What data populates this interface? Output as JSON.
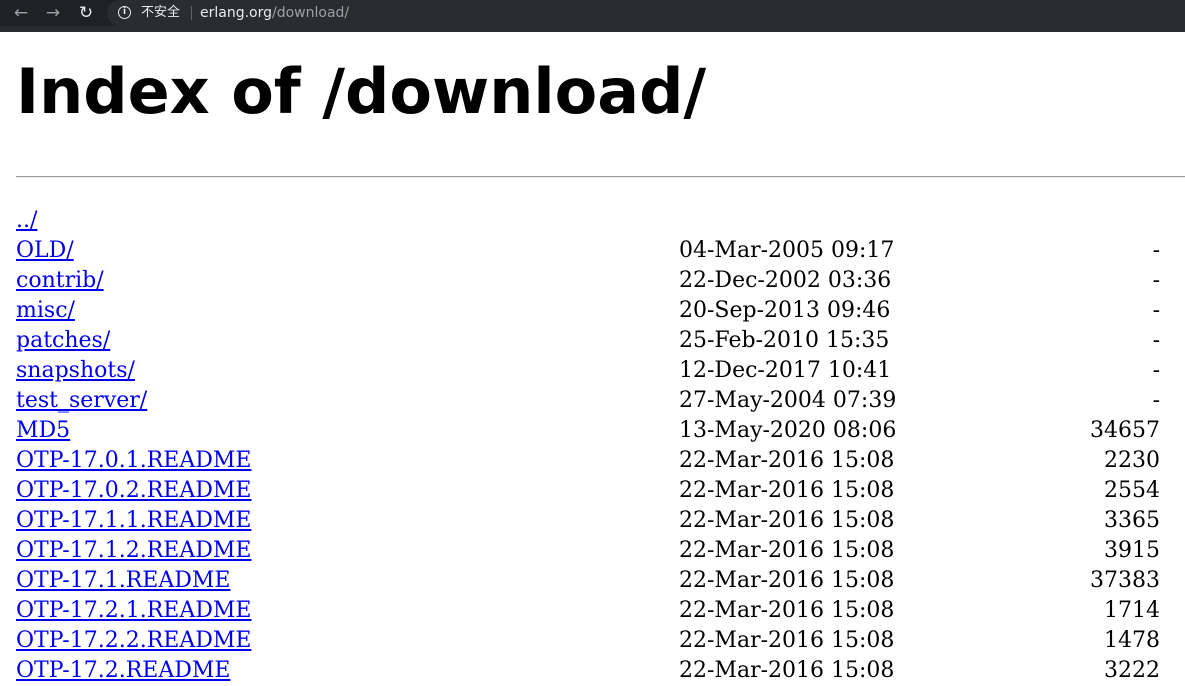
{
  "browser": {
    "security_label": "不安全",
    "url_domain": "erlang.org",
    "url_path": "/download/"
  },
  "page": {
    "title": "Index of /download/"
  },
  "entries": [
    {
      "name": "../",
      "date": "",
      "size": ""
    },
    {
      "name": "OLD/",
      "date": "04-Mar-2005 09:17",
      "size": "-"
    },
    {
      "name": "contrib/",
      "date": "22-Dec-2002 03:36",
      "size": "-"
    },
    {
      "name": "misc/",
      "date": "20-Sep-2013 09:46",
      "size": "-"
    },
    {
      "name": "patches/",
      "date": "25-Feb-2010 15:35",
      "size": "-"
    },
    {
      "name": "snapshots/",
      "date": "12-Dec-2017 10:41",
      "size": "-"
    },
    {
      "name": "test_server/",
      "date": "27-May-2004 07:39",
      "size": "-"
    },
    {
      "name": "MD5",
      "date": "13-May-2020 08:06",
      "size": "34657"
    },
    {
      "name": "OTP-17.0.1.README",
      "date": "22-Mar-2016 15:08",
      "size": "2230"
    },
    {
      "name": "OTP-17.0.2.README",
      "date": "22-Mar-2016 15:08",
      "size": "2554"
    },
    {
      "name": "OTP-17.1.1.README",
      "date": "22-Mar-2016 15:08",
      "size": "3365"
    },
    {
      "name": "OTP-17.1.2.README",
      "date": "22-Mar-2016 15:08",
      "size": "3915"
    },
    {
      "name": "OTP-17.1.README",
      "date": "22-Mar-2016 15:08",
      "size": "37383"
    },
    {
      "name": "OTP-17.2.1.README",
      "date": "22-Mar-2016 15:08",
      "size": "1714"
    },
    {
      "name": "OTP-17.2.2.README",
      "date": "22-Mar-2016 15:08",
      "size": "1478"
    },
    {
      "name": "OTP-17.2.README",
      "date": "22-Mar-2016 15:08",
      "size": "3222"
    }
  ]
}
